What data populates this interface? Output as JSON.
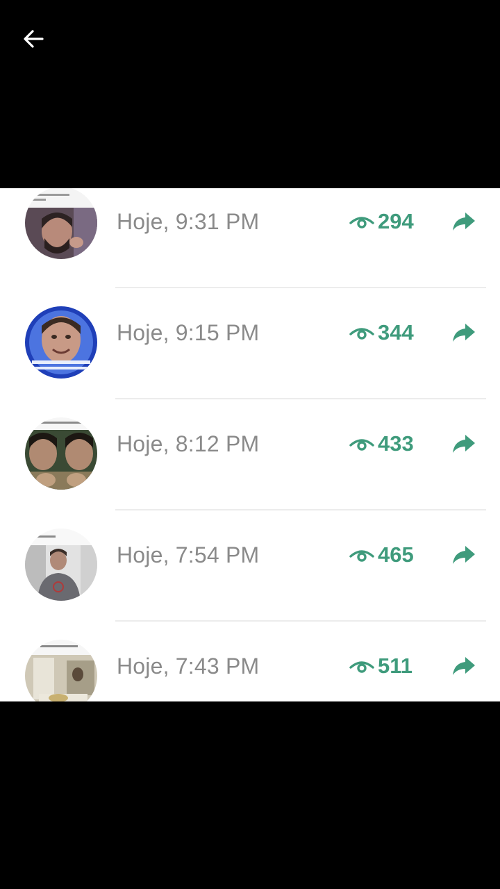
{
  "topbar": {
    "back_icon": "arrow-left-icon"
  },
  "colors": {
    "accent": "#3f9b7c",
    "timestamp_text": "#8a8a8a",
    "divider": "#ececec",
    "background": "#000000",
    "panel": "#ffffff"
  },
  "status_views": [
    {
      "time": "Hoje, 9:31 PM",
      "views": "294"
    },
    {
      "time": "Hoje, 9:15 PM",
      "views": "344"
    },
    {
      "time": "Hoje, 8:12 PM",
      "views": "433"
    },
    {
      "time": "Hoje, 7:54 PM",
      "views": "465"
    },
    {
      "time": "Hoje, 7:43 PM",
      "views": "511"
    }
  ],
  "icons": {
    "views": "eye-icon",
    "share": "share-arrow-icon"
  }
}
